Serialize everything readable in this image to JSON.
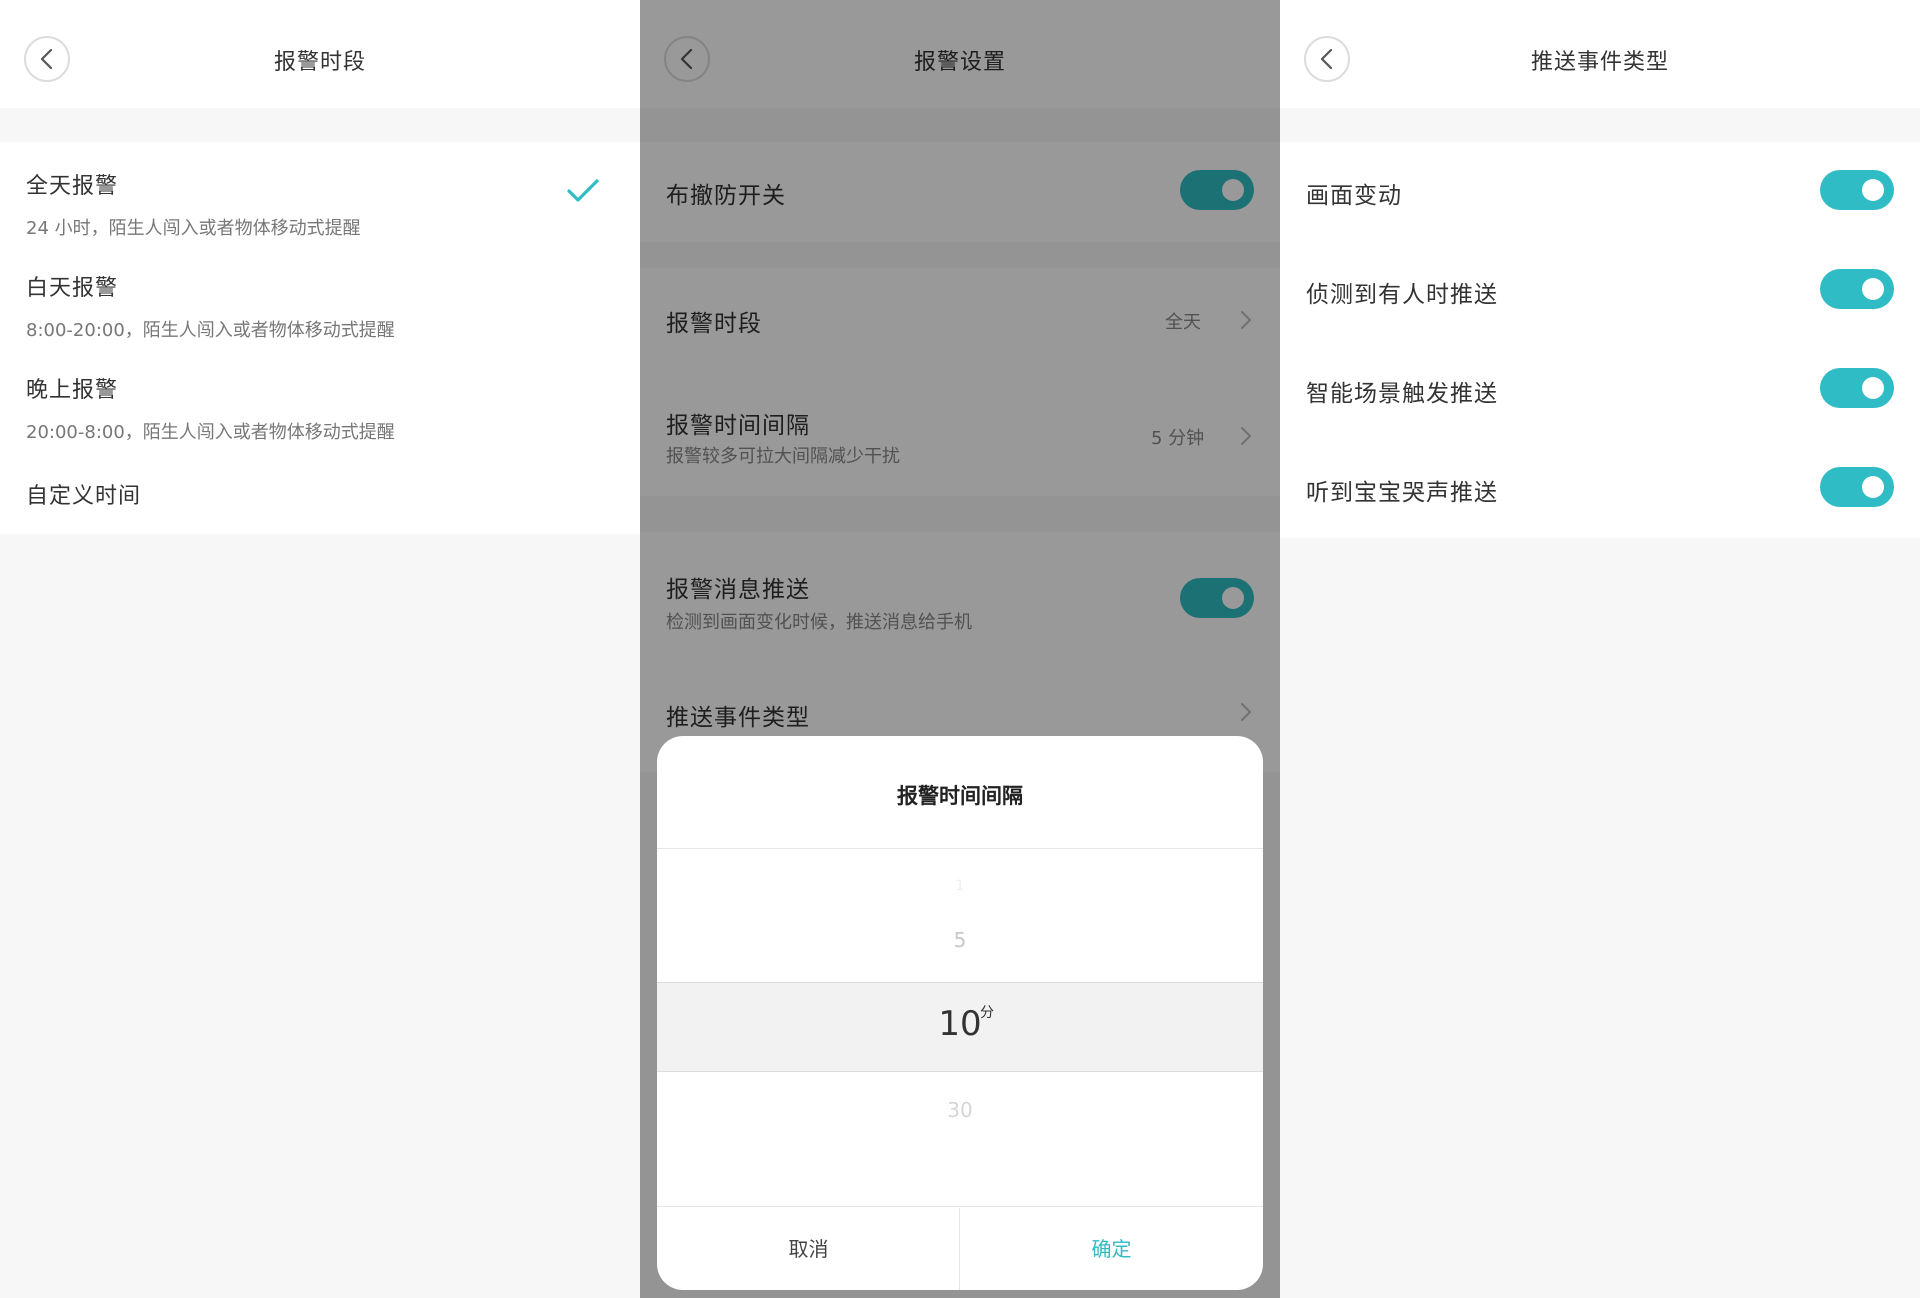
{
  "colors": {
    "accent": "#2fbcc4",
    "background": "#f7f7f7",
    "card": "#ffffff"
  },
  "panel1": {
    "title": "报警时段",
    "selected_index": 0,
    "options": [
      {
        "title": "全天报警",
        "desc": "24 小时，陌生人闯入或者物体移动式提醒"
      },
      {
        "title": "白天报警",
        "desc": "8:00-20:00，陌生人闯入或者物体移动式提醒"
      },
      {
        "title": "晚上报警",
        "desc": "20:00-8:00，陌生人闯入或者物体移动式提醒"
      },
      {
        "title": "自定义时间",
        "desc": ""
      }
    ]
  },
  "panel2": {
    "title": "报警设置",
    "arm_switch": {
      "label": "布撤防开关",
      "on": true
    },
    "period": {
      "label": "报警时段",
      "value": "全天"
    },
    "interval": {
      "label": "报警时间间隔",
      "sub": "报警较多可拉大间隔减少干扰",
      "value": "5 分钟"
    },
    "push": {
      "label": "报警消息推送",
      "sub": "检测到画面变化时候，推送消息给手机",
      "on": true
    },
    "event_types": {
      "label": "推送事件类型"
    },
    "dialog": {
      "title": "报警时间间隔",
      "options": [
        "1",
        "5",
        "10",
        "30"
      ],
      "selected": "10",
      "unit": "分",
      "cancel": "取消",
      "confirm": "确定"
    }
  },
  "panel3": {
    "title": "推送事件类型",
    "toggles": [
      {
        "label": "画面变动",
        "on": true
      },
      {
        "label": "侦测到有人时推送",
        "on": true
      },
      {
        "label": "智能场景触发推送",
        "on": true
      },
      {
        "label": "听到宝宝哭声推送",
        "on": true
      }
    ]
  }
}
